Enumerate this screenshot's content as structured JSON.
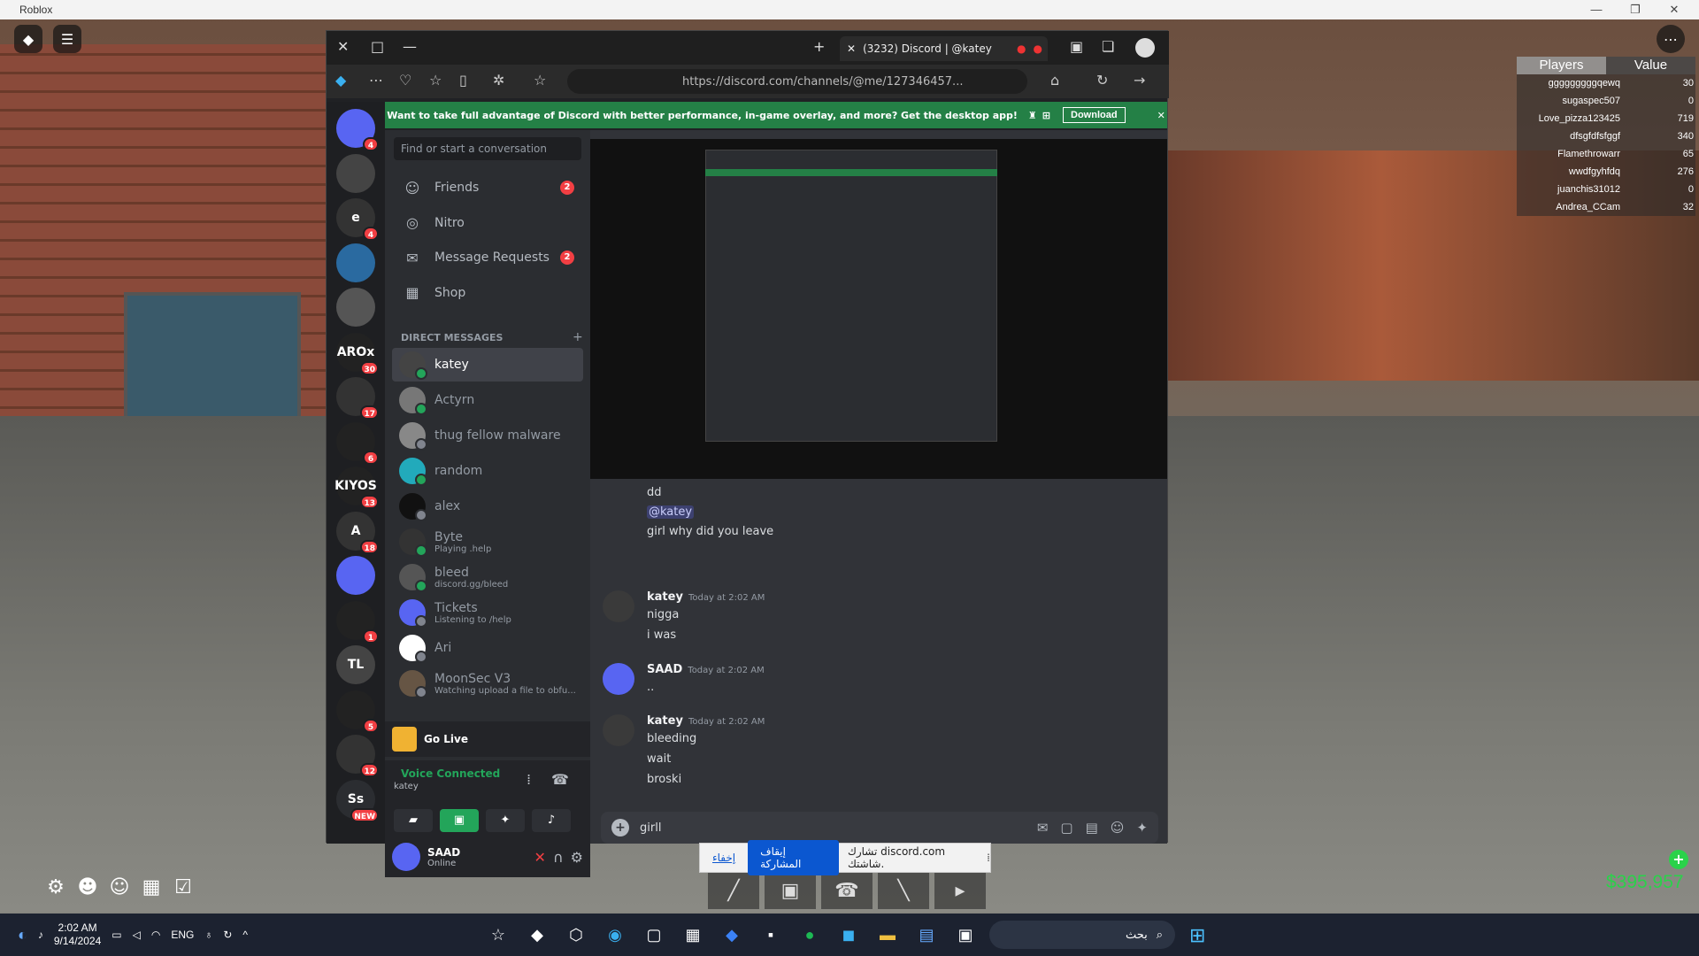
{
  "window": {
    "title": "Roblox"
  },
  "leaderboard": {
    "headers": [
      "Players",
      "Value"
    ],
    "rows": [
      {
        "name": "gggggggggqewq",
        "value": "30"
      },
      {
        "name": "sugaspec507",
        "value": "0"
      },
      {
        "name": "Love_pizza123425",
        "value": "719"
      },
      {
        "name": "dfsgfdfsfggf",
        "value": "340"
      },
      {
        "name": "Flamethrowarr",
        "value": "65"
      },
      {
        "name": "wwdfgyhfdq",
        "value": "276"
      },
      {
        "name": "juanchis31012",
        "value": "0"
      },
      {
        "name": "Andrea_CCam",
        "value": "32"
      }
    ]
  },
  "money": "$395,957",
  "browser": {
    "tab_title": "(3232) Discord | @katey",
    "url": "https://discord.com/channels/@me/127346457..."
  },
  "banner": {
    "text": "Want to take full advantage of Discord with better performance, in-game overlay, and more? Get the desktop app!",
    "download": "Download"
  },
  "guilds": [
    {
      "label": "",
      "badge": "4"
    },
    {
      "label": "",
      "badge": ""
    },
    {
      "label": "e",
      "badge": "4"
    },
    {
      "label": "",
      "badge": ""
    },
    {
      "label": "",
      "badge": ""
    },
    {
      "label": "AROx",
      "badge": "30"
    },
    {
      "label": "",
      "badge": "17"
    },
    {
      "label": "",
      "badge": "6"
    },
    {
      "label": "KIYOS",
      "badge": "13"
    },
    {
      "label": "A",
      "badge": "18"
    },
    {
      "label": "",
      "badge": ""
    },
    {
      "label": "",
      "badge": "1"
    },
    {
      "label": "TL",
      "badge": ""
    },
    {
      "label": "",
      "badge": "5"
    },
    {
      "label": "",
      "badge": "12"
    },
    {
      "label": "Ss",
      "badge": "NEW"
    }
  ],
  "dm": {
    "search_placeholder": "Find or start a conversation",
    "nav": [
      {
        "label": "Friends",
        "count": "2"
      },
      {
        "label": "Nitro",
        "count": ""
      },
      {
        "label": "Message Requests",
        "count": "2"
      },
      {
        "label": "Shop",
        "count": ""
      }
    ],
    "header": "DIRECT MESSAGES",
    "list": [
      {
        "name": "katey",
        "sub": ""
      },
      {
        "name": "Actyrn",
        "sub": ""
      },
      {
        "name": "thug fellow malware",
        "sub": ""
      },
      {
        "name": "random",
        "sub": ""
      },
      {
        "name": "alex",
        "sub": ""
      },
      {
        "name": "Byte",
        "sub": "Playing .help"
      },
      {
        "name": "bleed",
        "sub": "discord.gg/bleed"
      },
      {
        "name": "Tickets",
        "sub": "Listening to /help"
      },
      {
        "name": "Ari",
        "sub": ""
      },
      {
        "name": "MoonSec V3",
        "sub": "Watching upload a file to obfu..."
      }
    ],
    "golive": "Go Live",
    "voice_connected": "Voice Connected",
    "voice_channel": "katey",
    "user_name": "SAAD",
    "user_status": "Online"
  },
  "messages": {
    "cont": [
      "dd",
      "@katey",
      "girl why did you leave"
    ],
    "groups": [
      {
        "author": "katey",
        "time": "Today at 2:02 AM",
        "lines": [
          "nigga",
          "i was"
        ]
      },
      {
        "author": "SAAD",
        "time": "Today at 2:02 AM",
        "lines": [
          ".."
        ]
      },
      {
        "author": "katey",
        "time": "Today at 2:02 AM",
        "lines": [
          "bleeding",
          "wait",
          "broski"
        ]
      }
    ]
  },
  "composer": {
    "value": "girll"
  },
  "sharebar": {
    "hide": "إخفاء",
    "stop": "إيقاف المشاركة",
    "message": "تشارك discord.com شاشتك."
  },
  "taskbar": {
    "time": "2:02 AM",
    "date": "9/14/2024",
    "lang": "ENG",
    "search": "بحث"
  }
}
